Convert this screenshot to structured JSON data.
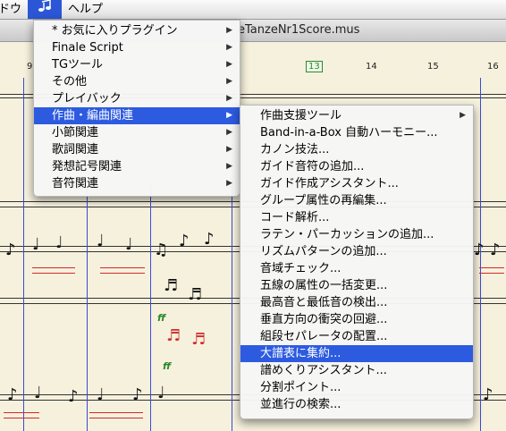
{
  "menubar": {
    "window_label": "ドウ",
    "plugins_icon": "music-note-icon",
    "help_label": "ヘルプ"
  },
  "window": {
    "title": "eTanzeNr1Score.mus"
  },
  "score": {
    "measure_numbers": [
      "9",
      "13",
      "14",
      "15",
      "16"
    ],
    "dynamics": [
      "ff",
      "ff"
    ]
  },
  "plugins_menu": {
    "items": [
      {
        "label": "* お気に入りプラグイン",
        "submenu": true
      },
      {
        "label": "Finale Script",
        "submenu": true
      },
      {
        "label": "TGツール",
        "submenu": true
      },
      {
        "label": "その他",
        "submenu": true
      },
      {
        "label": "プレイバック",
        "submenu": true
      },
      {
        "label": "作曲・編曲関連",
        "submenu": true,
        "selected": true
      },
      {
        "label": "小節関連",
        "submenu": true
      },
      {
        "label": "歌詞関連",
        "submenu": true
      },
      {
        "label": "発想記号関連",
        "submenu": true
      },
      {
        "label": "音符関連",
        "submenu": true
      }
    ]
  },
  "composition_submenu": {
    "items": [
      {
        "label": "作曲支援ツール",
        "submenu": true
      },
      {
        "label": "Band-in-a-Box 自動ハーモニー..."
      },
      {
        "label": "カノン技法..."
      },
      {
        "label": "ガイド音符の追加..."
      },
      {
        "label": "ガイド作成アシスタント..."
      },
      {
        "label": "グループ属性の再編集..."
      },
      {
        "label": "コード解析..."
      },
      {
        "label": "ラテン・パーカッションの追加..."
      },
      {
        "label": "リズムパターンの追加..."
      },
      {
        "label": "音域チェック..."
      },
      {
        "label": "五線の属性の一括変更..."
      },
      {
        "label": "最高音と最低音の検出..."
      },
      {
        "label": "垂直方向の衝突の回避..."
      },
      {
        "label": "組段セパレータの配置..."
      },
      {
        "label": "大譜表に集約...",
        "selected": true
      },
      {
        "label": "譜めくりアシスタント..."
      },
      {
        "label": "分割ポイント..."
      },
      {
        "label": "並進行の検索..."
      }
    ]
  },
  "colors": {
    "menu_highlight": "#2d5be0",
    "barline": "#3a4ad8",
    "hairpin": "#d12a2a",
    "dynamic": "#2a8a2a"
  }
}
